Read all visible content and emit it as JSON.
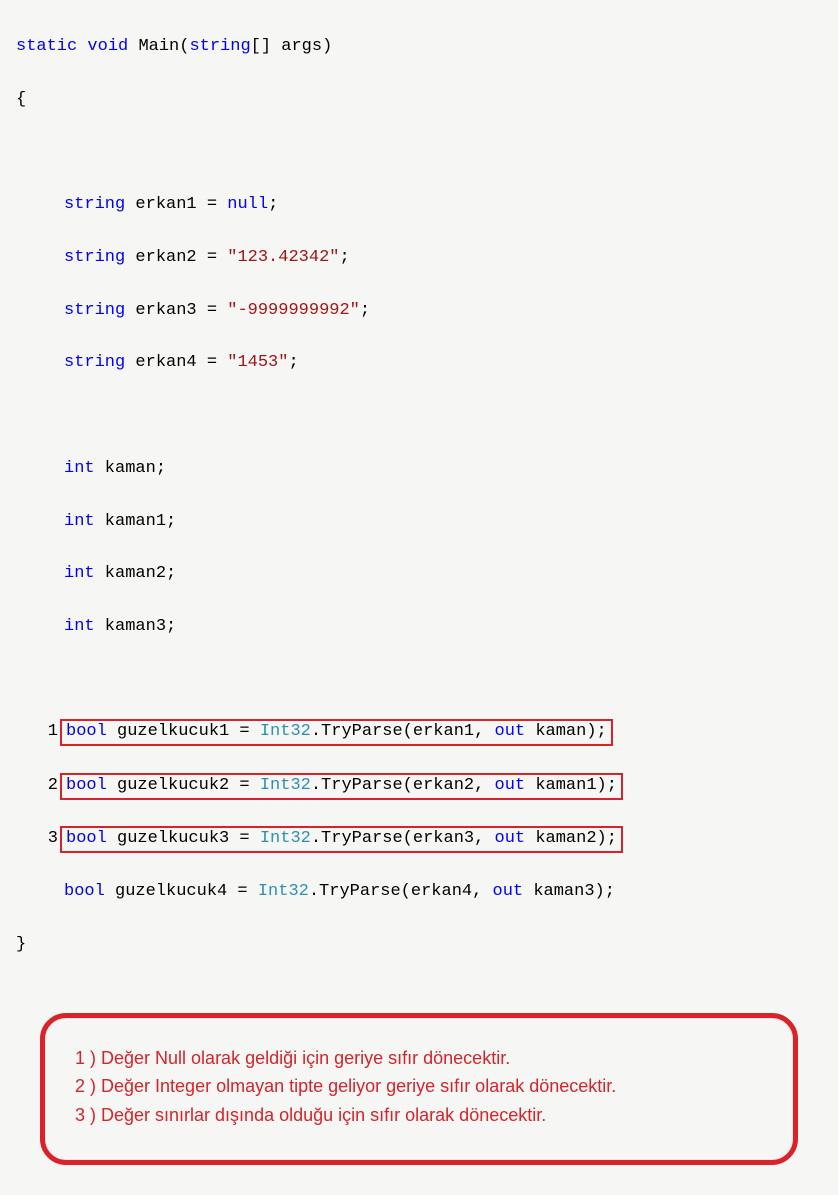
{
  "code": {
    "sig_static": "static",
    "sig_void": "void",
    "sig_main": "Main(",
    "sig_string": "string",
    "sig_args": "[] args)",
    "brace_open": "{",
    "brace_close": "}",
    "decl_string": "string",
    "decl_int": "int",
    "decl_bool": "bool",
    "kw_null": "null",
    "kw_out": "out",
    "cls_int32": "Int32",
    "method_tryparse": ".TryParse(",
    "var_erkan1": " erkan1 = ",
    "var_erkan2": " erkan2 = ",
    "var_erkan3": " erkan3 = ",
    "var_erkan4": " erkan4 = ",
    "val_erkan2": "\"123.42342\"",
    "val_erkan3": "\"-9999999992\"",
    "val_erkan4": "\"1453\"",
    "semicolon": ";",
    "int_kaman": " kaman;",
    "int_kaman1": " kaman1;",
    "int_kaman2": " kaman2;",
    "int_kaman3": " kaman3;",
    "gk1_a": " guzelkucuk1 = ",
    "gk2_a": " guzelkucuk2 = ",
    "gk3_a": " guzelkucuk3 = ",
    "gk4_a": " guzelkucuk4 = ",
    "tp1_args1": "erkan1, ",
    "tp1_args2": " kaman);",
    "tp2_args1": "erkan2, ",
    "tp2_args2": " kaman1);",
    "tp3_args1": "erkan3, ",
    "tp3_args2": " kaman2);",
    "tp4_args1": "erkan4, ",
    "tp4_args2": " kaman3);",
    "num1": "1",
    "num2": "2",
    "num3": "3"
  },
  "notes": {
    "n1": "1 ) Değer Null olarak geldiği için geriye sıfır dönecektir.",
    "n2": "2 ) Değer Integer olmayan tipte geliyor geriye sıfır olarak dönecektir.",
    "n3": "3 ) Değer sınırlar dışında olduğu için sıfır olarak dönecektir."
  }
}
